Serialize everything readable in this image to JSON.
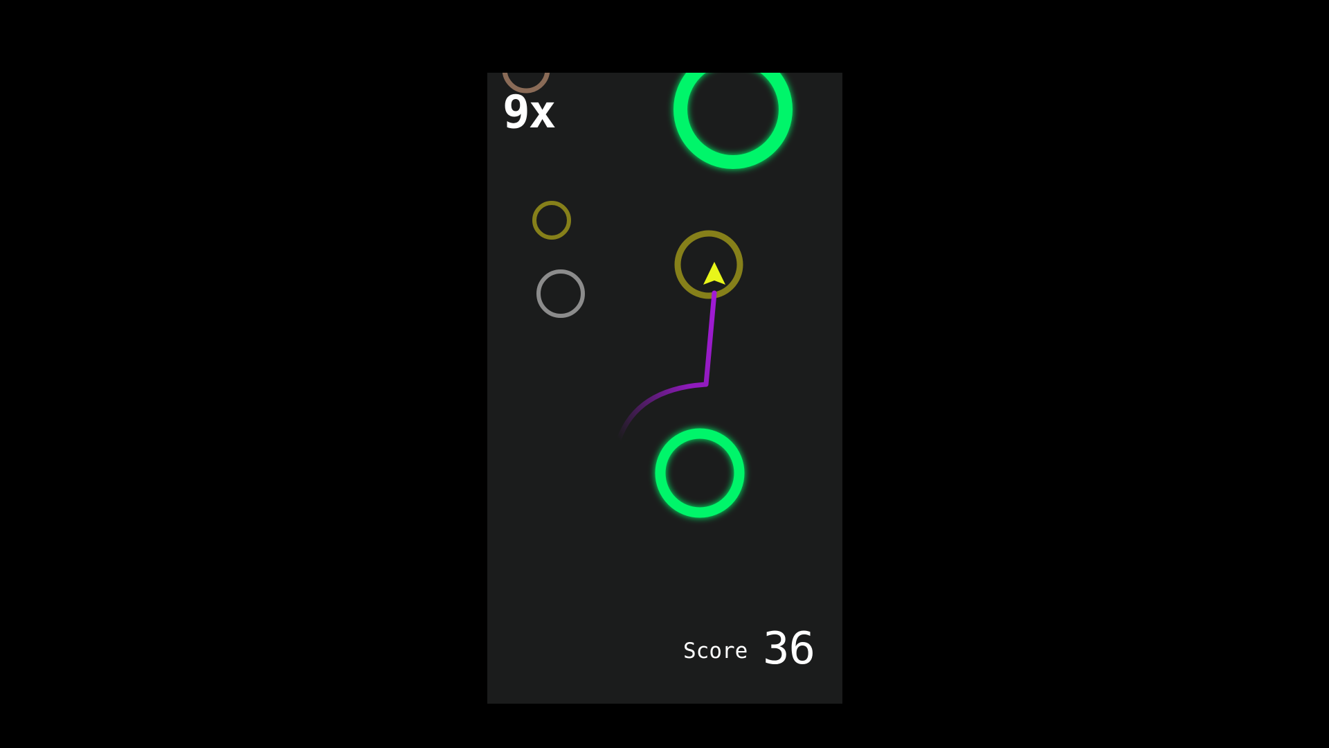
{
  "hud": {
    "multiplier": "9x",
    "score_label": "Score",
    "score_value": "36"
  },
  "colors": {
    "screen_background": "#000000",
    "play_area_background": "#1b1c1c",
    "ring_active": "#00f56a",
    "ring_olive": "#86801a",
    "ring_gray": "#8c8c8c",
    "ring_brown": "#8a6b57",
    "player_arrow": "#e8f51a",
    "trail": "#a21bd6",
    "hud_text": "#ffffff"
  },
  "scene": {
    "rings": [
      {
        "name": "ring-active-top",
        "kind": "active"
      },
      {
        "name": "ring-active-bottom",
        "kind": "active"
      },
      {
        "name": "ring-olive-current",
        "kind": "olive"
      },
      {
        "name": "ring-olive-small",
        "kind": "olive"
      },
      {
        "name": "ring-gray",
        "kind": "gray"
      },
      {
        "name": "ring-brown-partial",
        "kind": "brown"
      }
    ],
    "player": {
      "icon": "arrow-icon"
    },
    "trail": {
      "icon": "trail-line"
    }
  }
}
